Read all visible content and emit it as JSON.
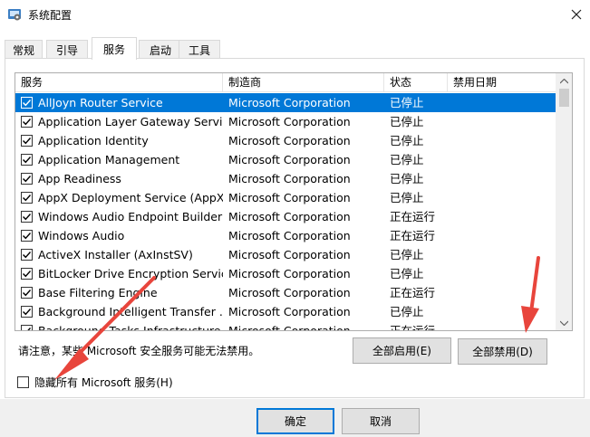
{
  "window": {
    "title": "系统配置"
  },
  "tabs": [
    {
      "label": "常规",
      "active": false
    },
    {
      "label": "引导",
      "active": false
    },
    {
      "label": "服务",
      "active": true
    },
    {
      "label": "启动",
      "active": false
    },
    {
      "label": "工具",
      "active": false
    }
  ],
  "services": {
    "columns": {
      "service": "服务",
      "manufacturer": "制造商",
      "status": "状态",
      "disabled_date": "禁用日期"
    },
    "rows": [
      {
        "name": "AllJoyn Router Service",
        "manufacturer": "Microsoft Corporation",
        "status": "已停止",
        "checked": true,
        "selected": true
      },
      {
        "name": "Application Layer Gateway Service",
        "manufacturer": "Microsoft Corporation",
        "status": "已停止",
        "checked": true
      },
      {
        "name": "Application Identity",
        "manufacturer": "Microsoft Corporation",
        "status": "已停止",
        "checked": true
      },
      {
        "name": "Application Management",
        "manufacturer": "Microsoft Corporation",
        "status": "已停止",
        "checked": true
      },
      {
        "name": "App Readiness",
        "manufacturer": "Microsoft Corporation",
        "status": "已停止",
        "checked": true
      },
      {
        "name": "AppX Deployment Service (AppX...",
        "manufacturer": "Microsoft Corporation",
        "status": "已停止",
        "checked": true
      },
      {
        "name": "Windows Audio Endpoint Builder",
        "manufacturer": "Microsoft Corporation",
        "status": "正在运行",
        "checked": true
      },
      {
        "name": "Windows Audio",
        "manufacturer": "Microsoft Corporation",
        "status": "正在运行",
        "checked": true
      },
      {
        "name": "ActiveX Installer (AxInstSV)",
        "manufacturer": "Microsoft Corporation",
        "status": "已停止",
        "checked": true
      },
      {
        "name": "BitLocker Drive Encryption Service",
        "manufacturer": "Microsoft Corporation",
        "status": "已停止",
        "checked": true
      },
      {
        "name": "Base Filtering Engine",
        "manufacturer": "Microsoft Corporation",
        "status": "正在运行",
        "checked": true
      },
      {
        "name": "Background Intelligent Transfer ...",
        "manufacturer": "Microsoft Corporation",
        "status": "已停止",
        "checked": true
      },
      {
        "name": "Background Tasks Infrastructure ...",
        "manufacturer": "Microsoft Corporation",
        "status": "正在运行",
        "checked": true
      }
    ]
  },
  "note": "请注意，某些 Microsoft 安全服务可能无法禁用。",
  "buttons": {
    "enable_all": "全部启用(E)",
    "disable_all": "全部禁用(D)",
    "ok": "确定",
    "cancel": "取消"
  },
  "hide_ms_checkbox": {
    "label": "隐藏所有 Microsoft 服务(H)",
    "checked": false
  },
  "colors": {
    "selection": "#0078d7",
    "annotation_arrow": "#e8453c"
  },
  "icons": {
    "app": "system-config-icon",
    "close": "close-icon",
    "scroll_up": "scroll-up-icon",
    "scroll_down": "scroll-down-icon"
  }
}
